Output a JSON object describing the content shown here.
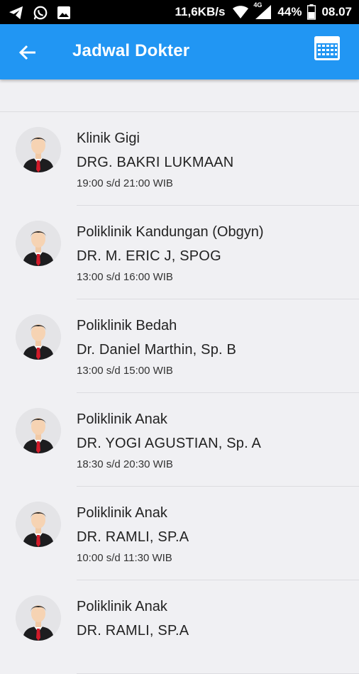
{
  "status_bar": {
    "net_speed": "11,6KB/s",
    "network_type": "4G",
    "battery": "44%",
    "time": "08.07",
    "left_icons": [
      "telegram-icon",
      "whatsapp-icon",
      "image-icon"
    ]
  },
  "app_bar": {
    "title": "Jadwal Dokter",
    "back_icon": "arrow-left-icon",
    "calendar_icon": "calendar-icon",
    "color": "#2196f3"
  },
  "doctors": [
    {
      "clinic": "Klinik Gigi",
      "doctor": "DRG. BAKRI LUKMAAN",
      "time": "19:00 s/d 21:00 WIB"
    },
    {
      "clinic": "Poliklinik Kandungan (Obgyn)",
      "doctor": "DR. M. ERIC J, SPOG",
      "time": "13:00 s/d 16:00 WIB"
    },
    {
      "clinic": "Poliklinik Bedah",
      "doctor": "Dr. Daniel Marthin, Sp. B",
      "time": "13:00 s/d 15:00 WIB"
    },
    {
      "clinic": "Poliklinik Anak",
      "doctor": "DR. YOGI AGUSTIAN, Sp. A",
      "time": "18:30 s/d 20:30 WIB"
    },
    {
      "clinic": "Poliklinik Anak",
      "doctor": "DR. RAMLI, SP.A",
      "time": "10:00 s/d 11:30 WIB"
    },
    {
      "clinic": "Poliklinik Anak",
      "doctor": "DR. RAMLI, SP.A",
      "time": ""
    }
  ]
}
